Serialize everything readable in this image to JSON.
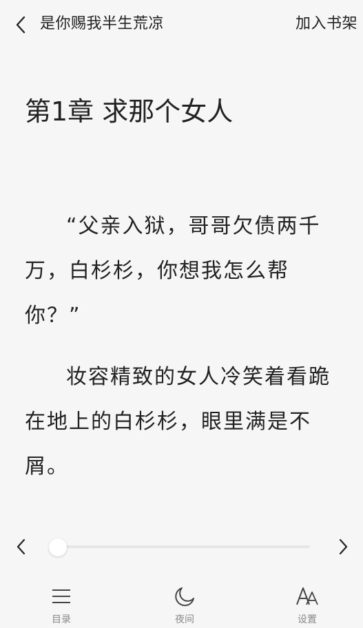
{
  "header": {
    "book_title": "是你赐我半生荒凉",
    "add_to_shelf": "加入书架"
  },
  "chapter": {
    "title": "第1章 求那个女人",
    "paragraphs": [
      "“父亲入狱，哥哥欠债两千万，白杉杉，你想我怎么帮你？”",
      "妆容精致的女人冷笑着看跪在地上的白杉杉，眼里满是不屑。"
    ]
  },
  "progress": {
    "value": 0
  },
  "bottom_nav": {
    "catalog": "目录",
    "night": "夜间",
    "settings": "设置"
  },
  "colors": {
    "background": "#f6f6f6",
    "text": "#222222",
    "nav_label": "#888888",
    "track": "#e6e6e6"
  }
}
